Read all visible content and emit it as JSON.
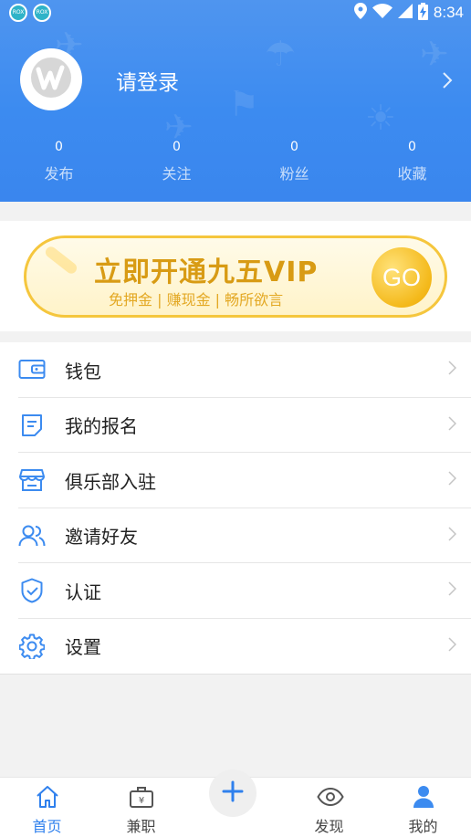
{
  "status_bar": {
    "time": "8:34",
    "left_icons": [
      "app-notification-icon",
      "app-notification-icon"
    ],
    "right_icons": [
      "location-icon",
      "wifi-icon",
      "signal-icon",
      "battery-charging-icon"
    ]
  },
  "profile": {
    "login_text": "请登录",
    "avatar_icon": "app-logo-icon"
  },
  "stats": [
    {
      "value": "0",
      "label": "发布"
    },
    {
      "value": "0",
      "label": "关注"
    },
    {
      "value": "0",
      "label": "粉丝"
    },
    {
      "value": "0",
      "label": "收藏"
    }
  ],
  "vip_banner": {
    "title": "立即开通九五VIP",
    "subtitle": "免押金 | 赚现金 | 畅所欲言",
    "go_label": "GO"
  },
  "menu": {
    "items": [
      {
        "label": "钱包",
        "icon": "wallet-icon"
      },
      {
        "label": "我的报名",
        "icon": "document-icon"
      },
      {
        "label": "俱乐部入驻",
        "icon": "store-icon"
      },
      {
        "label": "邀请好友",
        "icon": "users-icon"
      },
      {
        "label": "认证",
        "icon": "shield-check-icon"
      },
      {
        "label": "设置",
        "icon": "gear-icon"
      }
    ]
  },
  "tab_bar": {
    "tabs": [
      {
        "label": "首页",
        "icon": "home-icon",
        "active": true
      },
      {
        "label": "兼职",
        "icon": "briefcase-yen-icon",
        "active": false
      },
      {
        "label": "",
        "icon": "plus-icon",
        "active": false
      },
      {
        "label": "发现",
        "icon": "eye-icon",
        "active": false
      },
      {
        "label": "我的",
        "icon": "person-icon",
        "active": false
      }
    ]
  },
  "colors": {
    "primary": "#3c8bf0",
    "vip_gold": "#f5c63d",
    "active_tab": "#2f80ed"
  }
}
